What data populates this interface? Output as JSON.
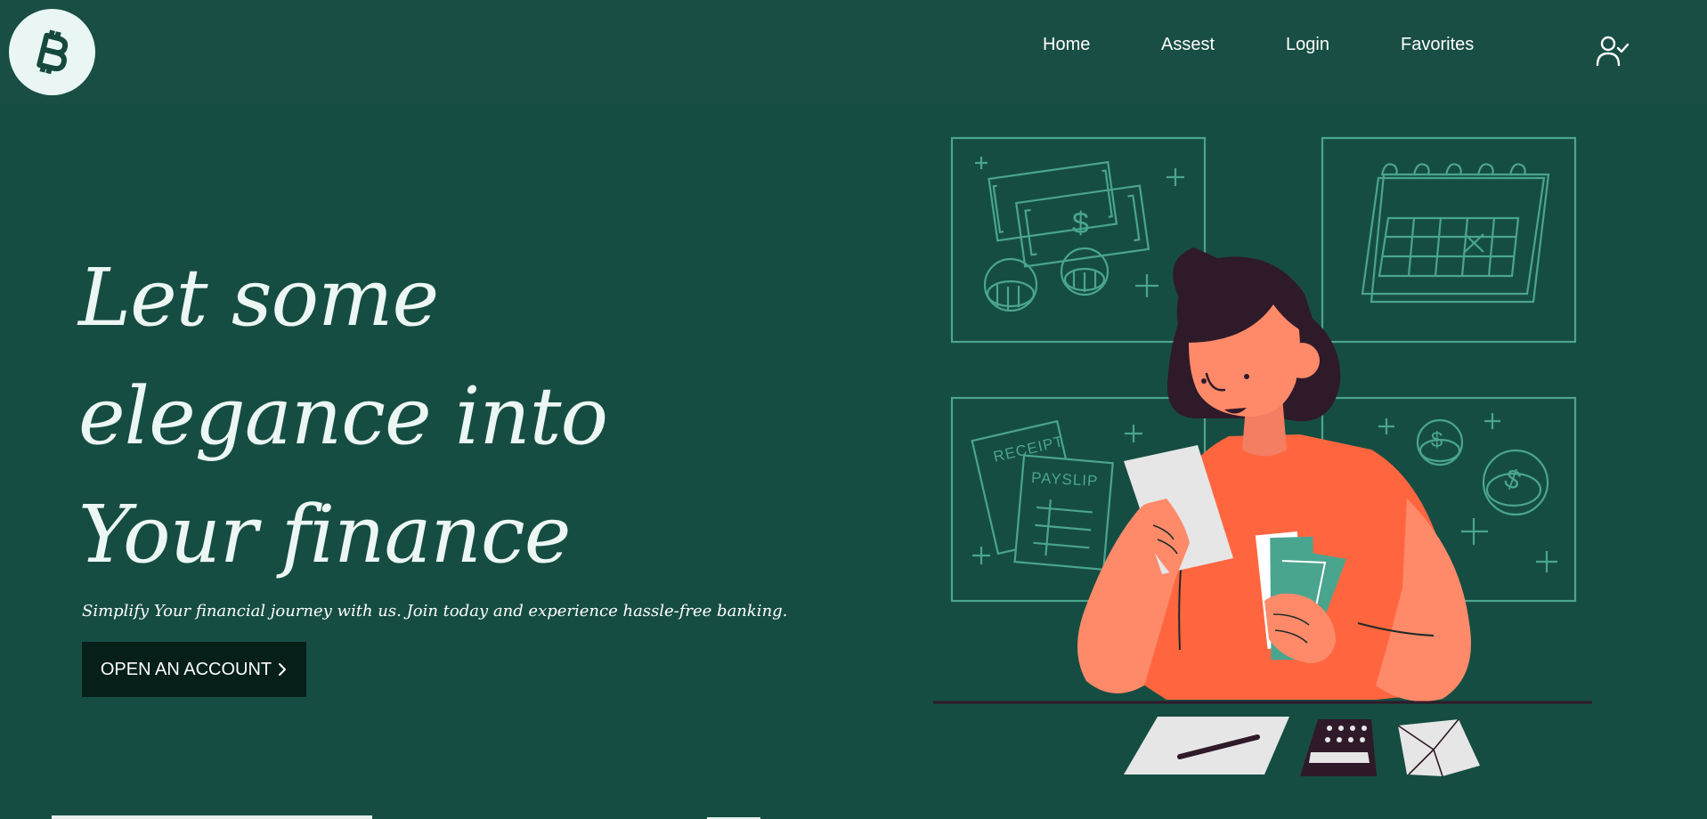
{
  "brand": {
    "logo_icon": "bitcoin-icon",
    "logo_color": "#15493e"
  },
  "nav": {
    "items": [
      {
        "label": "Home"
      },
      {
        "label": "Assest"
      },
      {
        "label": "Login"
      },
      {
        "label": "Favorites"
      }
    ],
    "user_icon": "user-check-icon"
  },
  "hero": {
    "title_lines": [
      "Let some",
      "elegance into",
      "Your finance"
    ],
    "subtitle": "Simplify Your financial journey with us. Join today and experience hassle-free banking.",
    "cta_label": "OPEN AN ACCOUNT",
    "cta_icon": "chevron-right-icon"
  },
  "illustration": {
    "receipt_label": "RECEIPT",
    "payslip_label": "PAYSLIP",
    "currency_symbol": "$"
  },
  "colors": {
    "background": "#164d42",
    "header": "#184e43",
    "accent_line": "#4aa58e",
    "shirt": "#ff6640",
    "button": "#061f19"
  }
}
